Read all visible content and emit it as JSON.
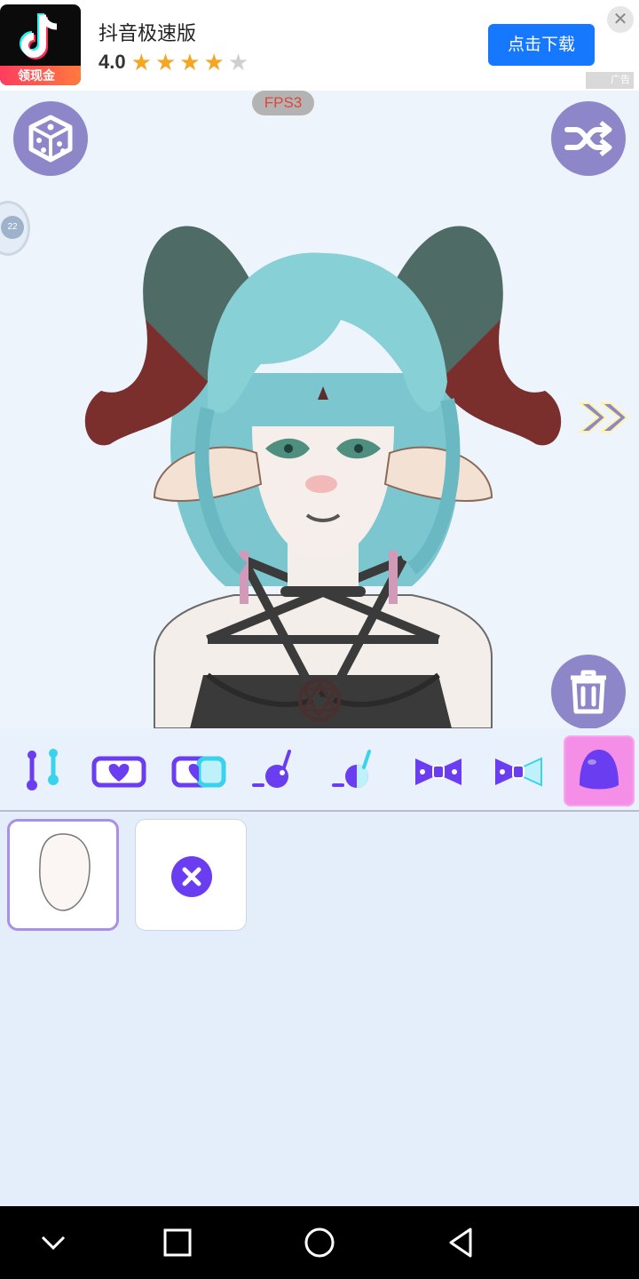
{
  "ad": {
    "app_name": "抖音极速版",
    "rating": "4.0",
    "stars_filled": 4,
    "stars_total": 5,
    "icon_badge": "领现金",
    "cta_label": "点击下载",
    "ad_tag": "广告"
  },
  "stage": {
    "fps_label": "FPS3",
    "side_badge_text": "22"
  },
  "toolbar": {
    "items": [
      {
        "name": "eyebrow-slider-icon",
        "active": false
      },
      {
        "name": "heart-card-icon",
        "active": false
      },
      {
        "name": "heart-card-alt-icon",
        "active": false
      },
      {
        "name": "accessory-ball-icon",
        "active": false
      },
      {
        "name": "accessory-ball-alt-icon",
        "active": false
      },
      {
        "name": "bow-icon",
        "active": false
      },
      {
        "name": "bow-alt-icon",
        "active": false
      },
      {
        "name": "face-shape-icon",
        "active": true
      }
    ]
  },
  "options": {
    "items": [
      {
        "name": "face-shape-option",
        "selected": true
      },
      {
        "name": "none-option",
        "selected": false
      }
    ]
  },
  "colors": {
    "accent_purple": "#8d86c8",
    "active_tab": "#f48ee6",
    "cta_blue": "#1677ff",
    "panel_bg": "#e4eefb"
  }
}
